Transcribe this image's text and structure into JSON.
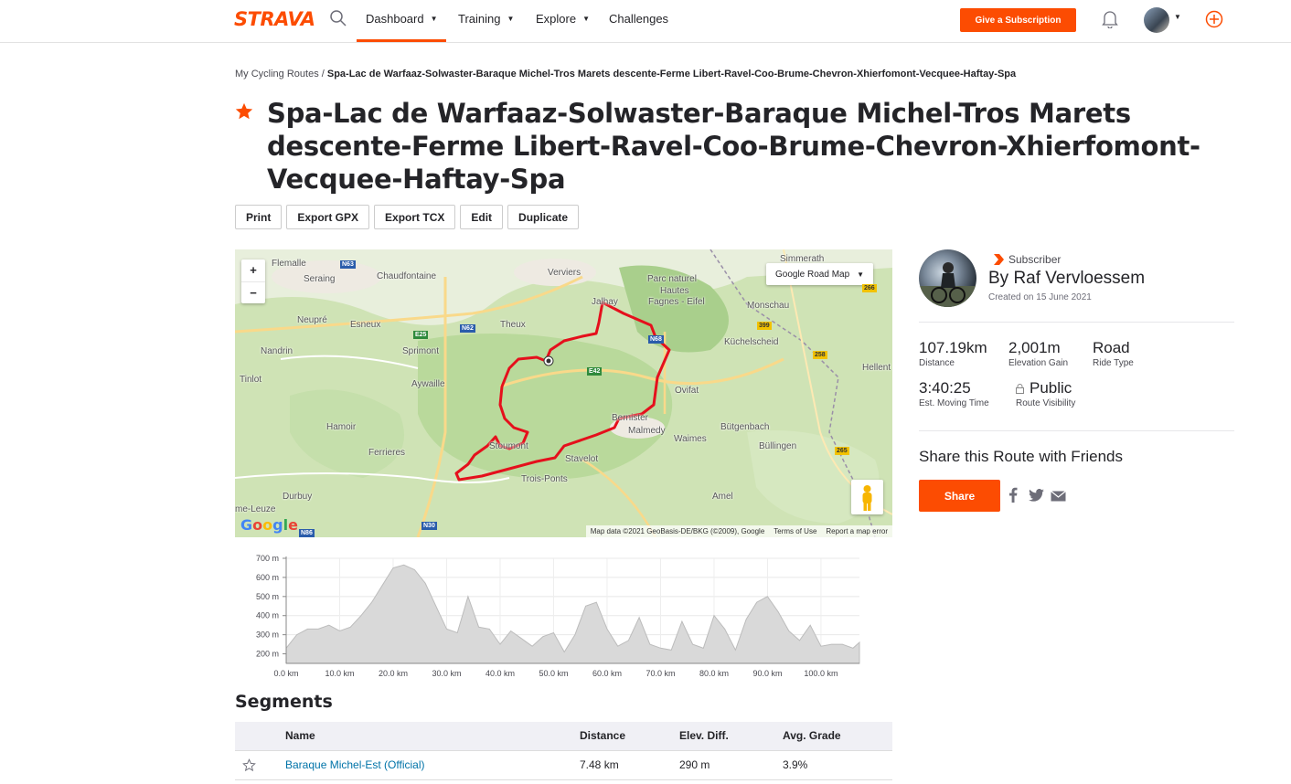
{
  "nav": {
    "logo": "STRAVA",
    "items": [
      {
        "label": "Dashboard"
      },
      {
        "label": "Training"
      },
      {
        "label": "Explore"
      },
      {
        "label": "Challenges"
      }
    ],
    "subscribe_label": "Give a Subscription"
  },
  "breadcrumb": {
    "parent": "My Cycling Routes",
    "separator": " / ",
    "current": "Spa-Lac de Warfaaz-Solwaster-Baraque Michel-Tros Marets descente-Ferme Libert-Ravel-Coo-Brume-Chevron-Xhierfomont-Vecquee-Haftay-Spa"
  },
  "route": {
    "title": "Spa-Lac de Warfaaz-Solwaster-Baraque Michel-Tros Marets descente-Ferme Libert-Ravel-Coo-Brume-Chevron-Xhierfomont-Vecquee-Haftay-Spa"
  },
  "actions": {
    "print": "Print",
    "export_gpx": "Export GPX",
    "export_tcx": "Export TCX",
    "edit": "Edit",
    "duplicate": "Duplicate"
  },
  "map": {
    "zoom_in": "+",
    "zoom_out": "−",
    "type_label": "Google Road Map",
    "google": "Google",
    "attribution": "Map data ©2021 GeoBasis-DE/BKG (©2009), Google",
    "terms": "Terms of Use",
    "report": "Report a map error",
    "places": [
      "Flemalle",
      "Seraing",
      "Chaudfontaine",
      "Verviers",
      "Parc naturel",
      "Hautes",
      "Fagnes - Eifel",
      "Simmerath",
      "Monschau",
      "Jalhay",
      "Neupré",
      "Esneux",
      "Theux",
      "Küchelscheid",
      "Nandrin",
      "Sprimont",
      "Tinlot",
      "Aywaille",
      "Ovifat",
      "Hellent",
      "Hamoir",
      "Bernister",
      "Malmedy",
      "Bütgenbach",
      "Waimes",
      "Büllingen",
      "Ferrieres",
      "Stoumont",
      "Stavelot",
      "Trois-Ponts",
      "Durbuy",
      "Amel",
      "me-Leuze"
    ],
    "roads": [
      "N63",
      "N62",
      "E25",
      "E42",
      "N68",
      "N30",
      "N86",
      "399",
      "258",
      "266",
      "265"
    ]
  },
  "elevation": {
    "y_ticks": [
      "700 m",
      "600 m",
      "500 m",
      "400 m",
      "300 m",
      "200 m"
    ],
    "x_ticks": [
      "0.0 km",
      "10.0 km",
      "20.0 km",
      "30.0 km",
      "40.0 km",
      "50.0 km",
      "60.0 km",
      "70.0 km",
      "80.0 km",
      "90.0 km",
      "100.0 km"
    ],
    "profile_km": [
      0,
      2,
      4,
      6,
      8,
      10,
      12,
      14,
      16,
      18,
      20,
      22,
      24,
      26,
      28,
      30,
      32,
      34,
      36,
      38,
      40,
      42,
      44,
      46,
      48,
      50,
      52,
      54,
      56,
      58,
      60,
      62,
      64,
      66,
      68,
      70,
      72,
      74,
      76,
      78,
      80,
      82,
      84,
      86,
      88,
      90,
      92,
      94,
      96,
      98,
      100,
      102,
      104,
      106,
      107.19
    ],
    "profile_m": [
      230,
      300,
      330,
      330,
      350,
      320,
      340,
      400,
      470,
      560,
      650,
      665,
      640,
      570,
      450,
      330,
      310,
      500,
      340,
      330,
      250,
      320,
      280,
      240,
      290,
      310,
      210,
      300,
      450,
      470,
      330,
      240,
      270,
      390,
      250,
      230,
      220,
      370,
      250,
      230,
      400,
      330,
      220,
      380,
      470,
      500,
      420,
      320,
      270,
      350,
      240,
      250,
      250,
      230,
      260
    ]
  },
  "segments": {
    "heading": "Segments",
    "columns": [
      "Name",
      "Distance",
      "Elev. Diff.",
      "Avg. Grade"
    ],
    "rows": [
      {
        "name": "Baraque Michel-Est (Official)",
        "distance": "7.48 km",
        "elev": "290 m",
        "grade": "3.9%"
      }
    ]
  },
  "author": {
    "badge": "Subscriber",
    "name": "By Raf Vervloessem",
    "created": "Created on 15 June 2021"
  },
  "stats": {
    "distance": {
      "value": "107.19km",
      "label": "Distance"
    },
    "elevation": {
      "value": "2,001m",
      "label": "Elevation Gain"
    },
    "ride_type": {
      "value": "Road",
      "label": "Ride Type"
    },
    "moving_time": {
      "value": "3:40:25",
      "label": "Est. Moving Time"
    },
    "visibility": {
      "value": "Public",
      "label": "Route Visibility"
    }
  },
  "share": {
    "heading": "Share this Route with Friends",
    "button": "Share"
  },
  "colors": {
    "brand": "#fc4c02",
    "route": "#e5101c",
    "link": "#0073a8"
  }
}
